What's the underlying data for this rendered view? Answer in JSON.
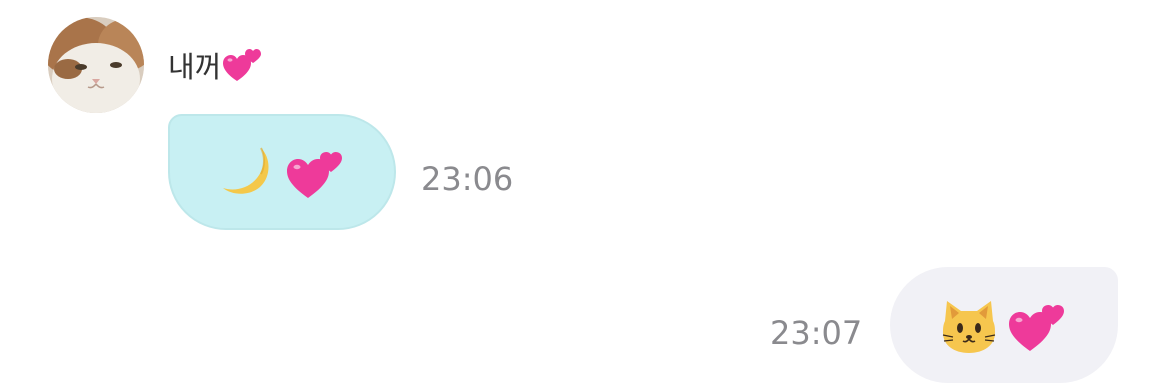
{
  "chat": {
    "sender": {
      "name": "내꺼",
      "name_icon": "two-hearts-icon",
      "avatar_icon": "cat-photo-avatar"
    },
    "messages": [
      {
        "direction": "incoming",
        "content_icons": [
          "crescent-moon-icon",
          "two-hearts-icon"
        ],
        "time": "23:06"
      },
      {
        "direction": "outgoing",
        "content_icons": [
          "cat-face-icon",
          "two-hearts-icon"
        ],
        "time": "23:07"
      }
    ],
    "colors": {
      "incoming_bubble": "#c8f0f3",
      "outgoing_bubble": "#f1f1f6",
      "time_text": "#8a8a8e",
      "heart": "#ee3a9a"
    }
  }
}
